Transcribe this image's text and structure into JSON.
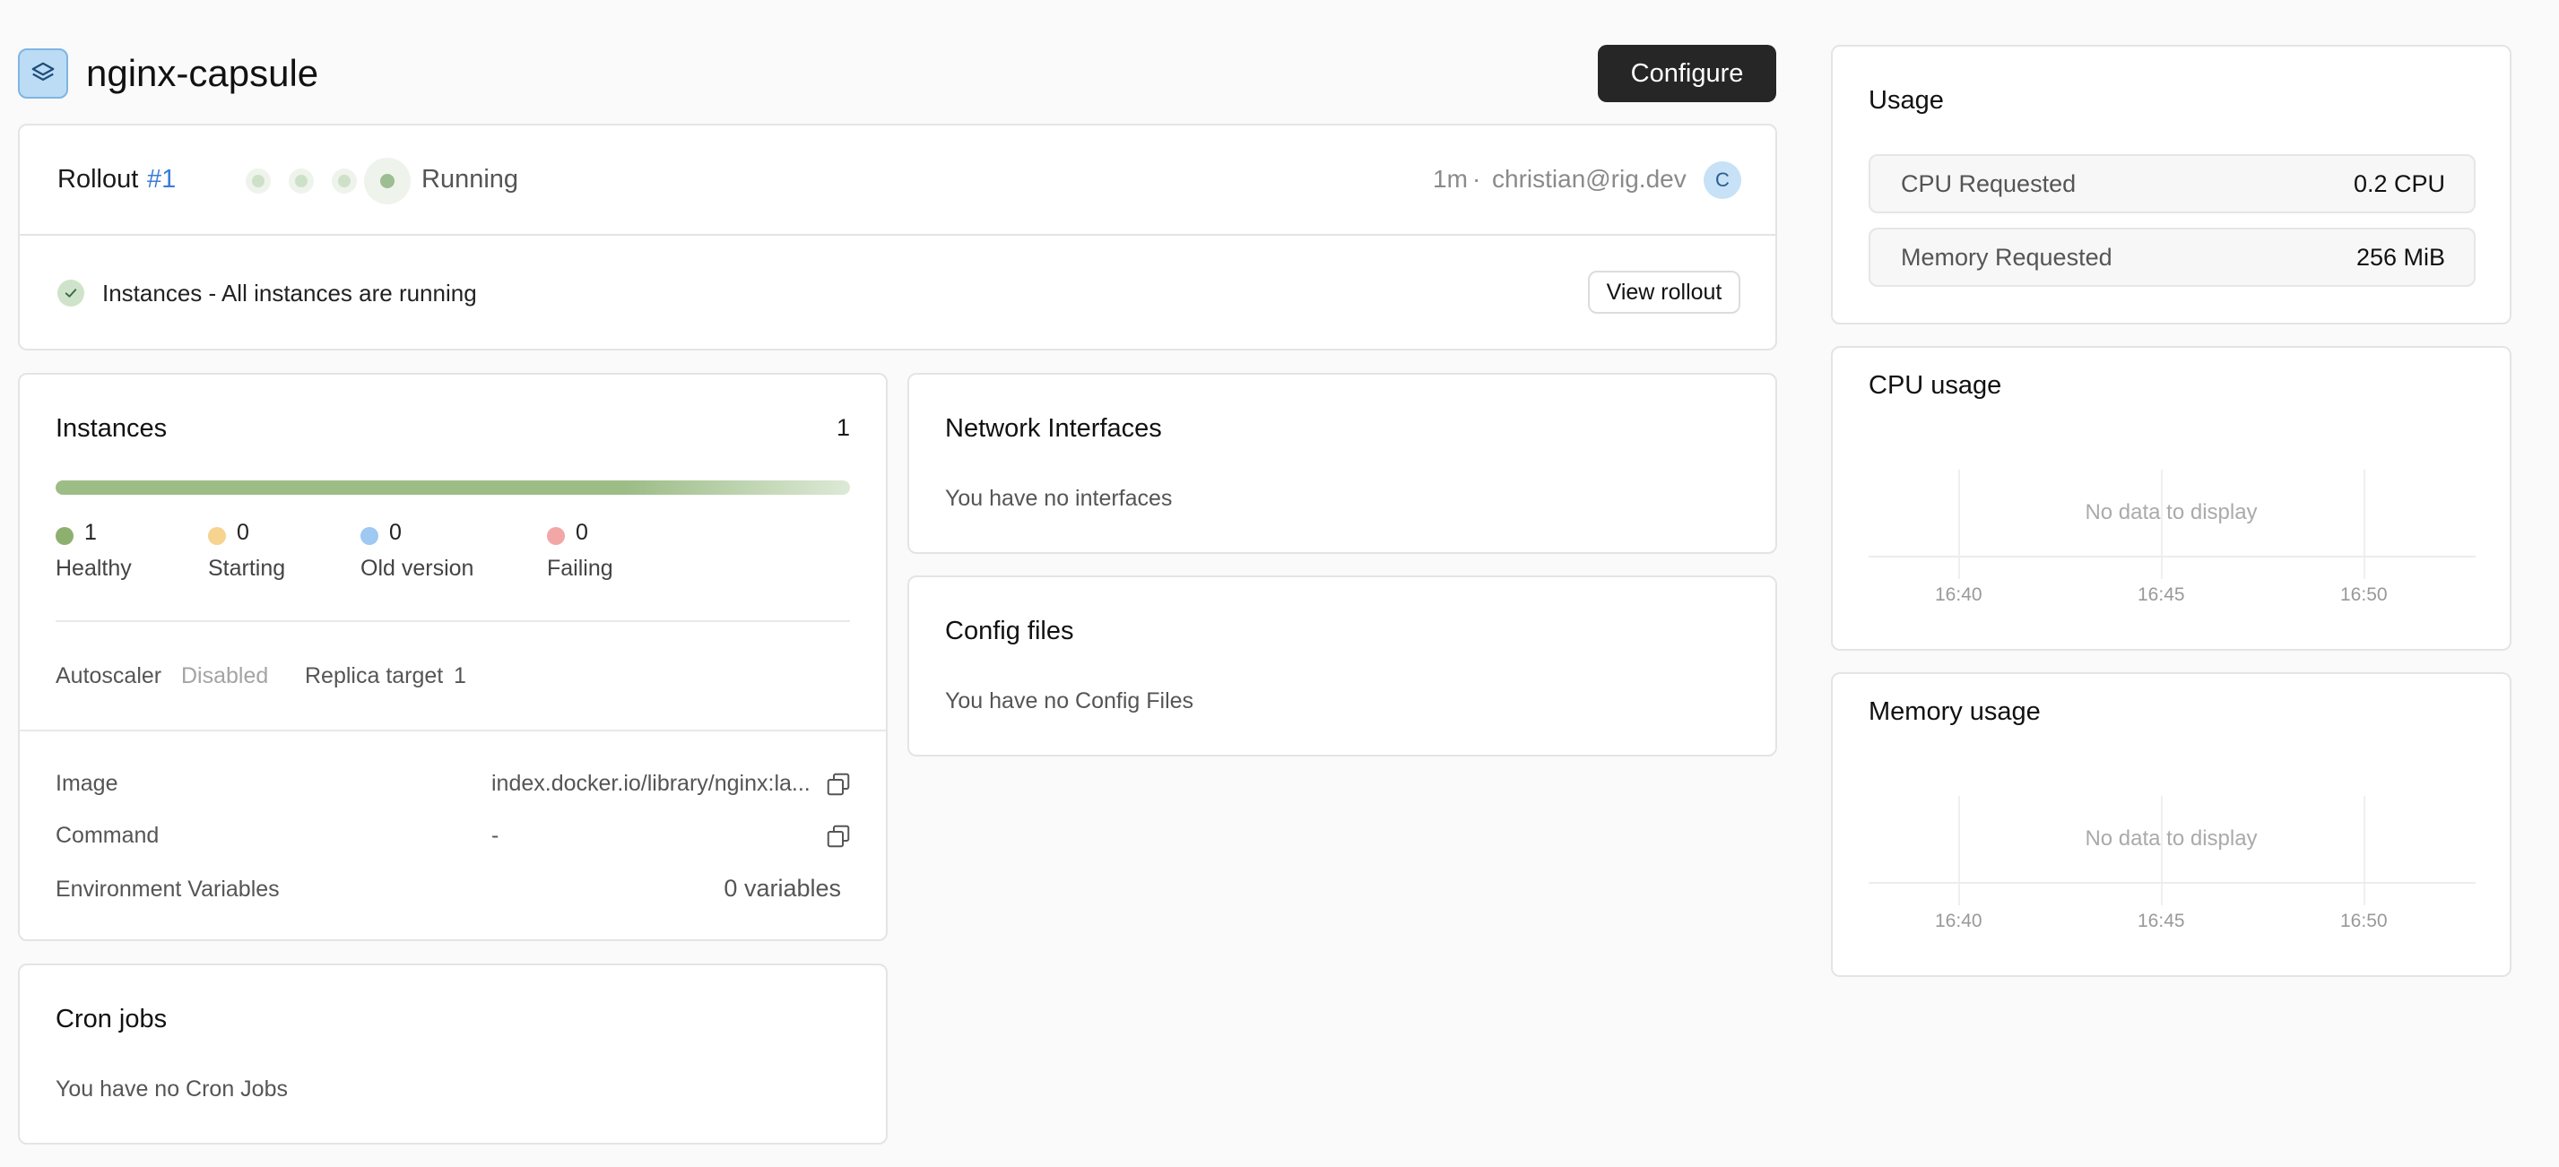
{
  "header": {
    "title": "nginx-capsule",
    "configure_label": "Configure",
    "app_icon": "layers-icon"
  },
  "rollout": {
    "label": "Rollout",
    "number": "#1",
    "status": "Running",
    "time": "1m",
    "separator": "·",
    "author": "christian@rig.dev",
    "avatar_initial": "C",
    "instances_message": "Instances - All instances are running",
    "view_rollout_label": "View rollout"
  },
  "instances": {
    "title": "Instances",
    "count": "1",
    "legend": [
      {
        "count": "1",
        "label": "Healthy",
        "color": "#8db06f"
      },
      {
        "count": "0",
        "label": "Starting",
        "color": "#f6d38e"
      },
      {
        "count": "0",
        "label": "Old version",
        "color": "#9fc8f3"
      },
      {
        "count": "0",
        "label": "Failing",
        "color": "#f2a6a6"
      }
    ],
    "autoscaler_label": "Autoscaler",
    "autoscaler_value": "Disabled",
    "replica_label": "Replica target",
    "replica_value": "1",
    "image_label": "Image",
    "image_value": "index.docker.io/library/nginx:la...",
    "command_label": "Command",
    "command_value": "-",
    "env_label": "Environment Variables",
    "env_value": "0 variables"
  },
  "network": {
    "title": "Network Interfaces",
    "empty": "You have no interfaces"
  },
  "config": {
    "title": "Config files",
    "empty": "You have no Config Files"
  },
  "cron": {
    "title": "Cron jobs",
    "empty": "You have no Cron Jobs"
  },
  "usage": {
    "title": "Usage",
    "cpu_label": "CPU Requested",
    "cpu_value": "0.2 CPU",
    "mem_label": "Memory Requested",
    "mem_value": "256 MiB"
  },
  "cpu_chart": {
    "title": "CPU usage",
    "empty": "No data to display",
    "ticks": [
      "16:40",
      "16:45",
      "16:50"
    ]
  },
  "memory_chart": {
    "title": "Memory usage",
    "empty": "No data to display",
    "ticks": [
      "16:40",
      "16:45",
      "16:50"
    ]
  }
}
